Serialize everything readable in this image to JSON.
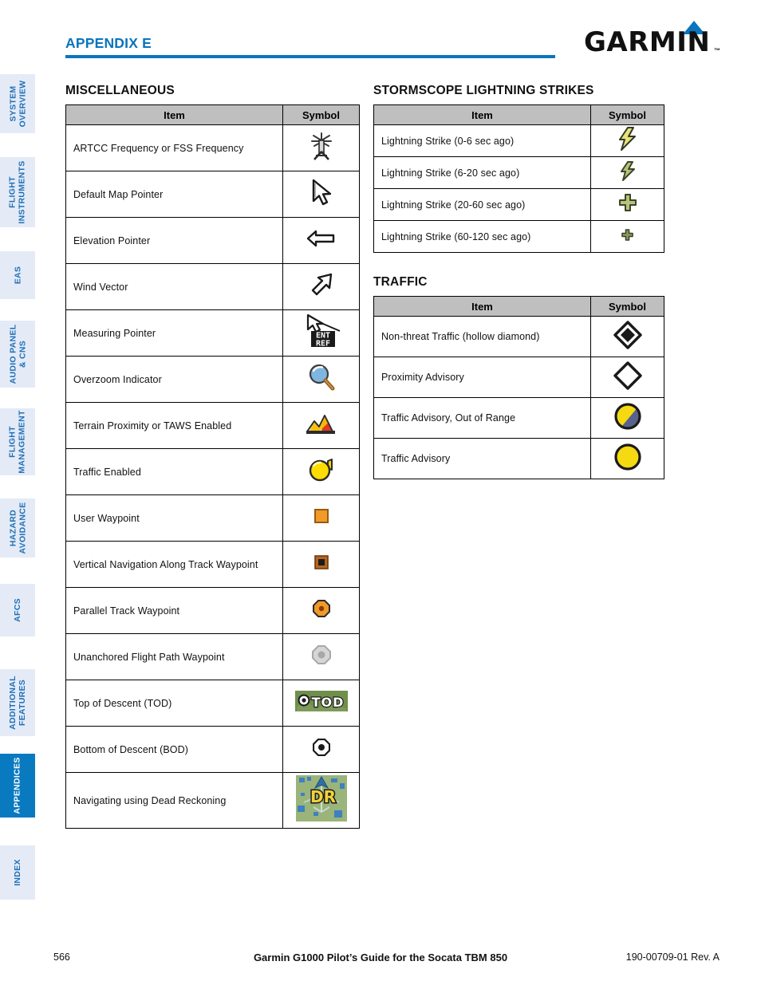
{
  "header": {
    "appendix_title": "APPENDIX E",
    "logo_text": "GARMIN",
    "logo_tm": "™",
    "accent_color": "#0a75bc"
  },
  "sidebar": {
    "items": [
      {
        "label": "SYSTEM OVERVIEW",
        "active": false
      },
      {
        "label": "FLIGHT INSTRUMENTS",
        "active": false
      },
      {
        "label": "EAS",
        "active": false
      },
      {
        "label": "AUDIO PANEL & CNS",
        "active": false
      },
      {
        "label": "FLIGHT MANAGEMENT",
        "active": false
      },
      {
        "label": "HAZARD AVOIDANCE",
        "active": false
      },
      {
        "label": "AFCS",
        "active": false
      },
      {
        "label": "ADDITIONAL FEATURES",
        "active": false
      },
      {
        "label": "APPENDICES",
        "active": true
      },
      {
        "label": "INDEX",
        "active": false
      }
    ],
    "active_color": "#0a7ac0",
    "inactive_bg": "#e4ebf7",
    "inactive_fg": "#1f6fb6"
  },
  "columns": {
    "header_item": "Item",
    "header_symbol": "Symbol"
  },
  "miscellaneous": {
    "title": "MISCELLANEOUS",
    "rows": [
      {
        "item": "ARTCC Frequency or FSS Frequency",
        "icon": "radio-tower-icon"
      },
      {
        "item": "Default Map Pointer",
        "icon": "map-pointer-icon"
      },
      {
        "item": "Elevation Pointer",
        "icon": "elevation-pointer-icon"
      },
      {
        "item": "Wind Vector",
        "icon": "wind-vector-icon"
      },
      {
        "item": "Measuring Pointer",
        "icon": "measuring-pointer-icon"
      },
      {
        "item": "Overzoom Indicator",
        "icon": "magnifier-icon"
      },
      {
        "item": "Terrain Proximity or TAWS Enabled",
        "icon": "terrain-icon"
      },
      {
        "item": "Traffic Enabled",
        "icon": "traffic-enabled-icon"
      },
      {
        "item": "User Waypoint",
        "icon": "user-waypoint-icon"
      },
      {
        "item": "Vertical Navigation Along Track Waypoint",
        "icon": "vnav-waypoint-icon"
      },
      {
        "item": "Parallel Track Waypoint",
        "icon": "parallel-track-waypoint-icon"
      },
      {
        "item": "Unanchored Flight Path Waypoint",
        "icon": "unanchored-waypoint-icon"
      },
      {
        "item": "Top of Descent (TOD)",
        "icon": "top-of-descent-icon",
        "icon_text": "TOD"
      },
      {
        "item": "Bottom of Descent (BOD)",
        "icon": "bottom-of-descent-icon"
      },
      {
        "item": "Navigating using Dead Reckoning",
        "icon": "dead-reckoning-icon",
        "icon_text": "DR"
      }
    ]
  },
  "stormscope": {
    "title": "STORMSCOPE LIGHTNING STRIKES",
    "rows": [
      {
        "item": "Lightning Strike (0-6 sec ago)",
        "icon": "lightning-bolt-bright-icon"
      },
      {
        "item": "Lightning Strike (6-20 sec ago)",
        "icon": "lightning-bolt-dim-icon"
      },
      {
        "item": "Lightning Strike (20-60 sec ago)",
        "icon": "lightning-cross-large-icon"
      },
      {
        "item": "Lightning Strike (60-120 sec ago)",
        "icon": "lightning-cross-small-icon"
      }
    ]
  },
  "traffic": {
    "title": "TRAFFIC",
    "rows": [
      {
        "item": "Non-threat Traffic (hollow diamond)",
        "icon": "nonthreat-diamond-icon"
      },
      {
        "item": "Proximity Advisory",
        "icon": "proximity-diamond-icon"
      },
      {
        "item": "Traffic Advisory, Out of Range",
        "icon": "traffic-advisory-out-of-range-icon"
      },
      {
        "item": "Traffic Advisory",
        "icon": "traffic-advisory-icon"
      }
    ]
  },
  "footer": {
    "page_number": "566",
    "document_title": "Garmin G1000 Pilot’s Guide for the Socata TBM 850",
    "part_number": "190-00709-01  Rev. A"
  }
}
